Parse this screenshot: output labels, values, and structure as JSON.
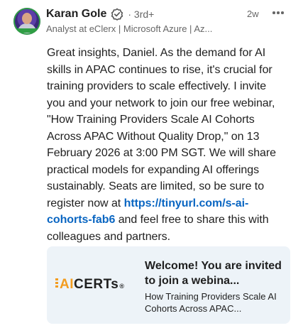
{
  "author": {
    "name": "Karan Gole",
    "degree": "· 3rd+",
    "headline": "Analyst at eClerx | Microsoft Azure | Az...",
    "time": "2w"
  },
  "comment": {
    "text_before": " Great insights, Daniel. As the demand for AI skills in APAC continues to rise, it's crucial for training providers to scale effectively. I invite you and your network to join our free webinar, \"How Training Providers Scale AI Cohorts Across APAC Without Quality Drop,\" on 13 February 2026 at 3:00 PM SGT. We will share practical models for expanding AI offerings sustainably. Seats are limited, so be sure to register now at ",
    "link": "https://tinyurl.com/s-ai-cohorts-fab6",
    "text_after": " and feel free to share this with colleagues and partners."
  },
  "preview": {
    "logo_ai": "AI",
    "logo_certs": "CERTs",
    "logo_reg": "®",
    "title": "Welcome! You are invited to join a webina...",
    "description": "How Training Providers Scale AI Cohorts Across APAC..."
  },
  "colors": {
    "link": "#0a66c2",
    "card_bg": "#edf3f8",
    "logo_accent": "#f39c1f"
  },
  "icons": [
    "verified-badge-icon",
    "more-options-icon"
  ]
}
